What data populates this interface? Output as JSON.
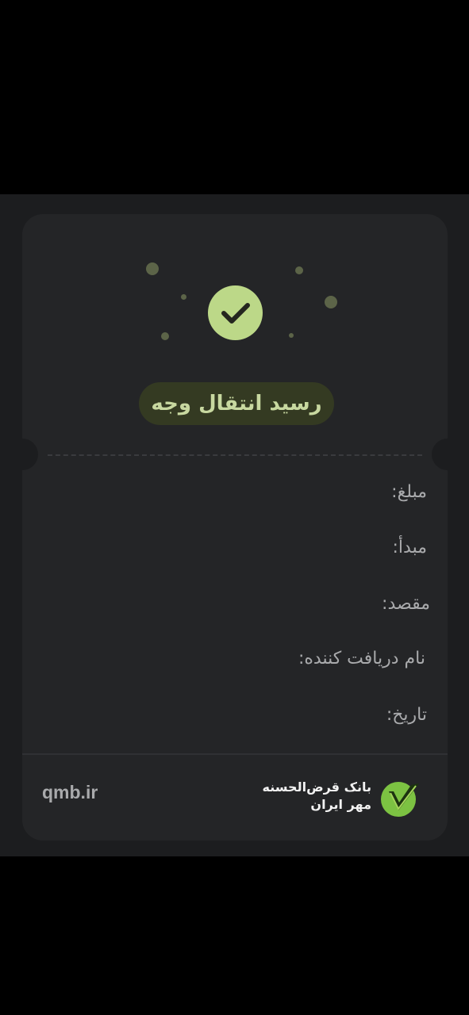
{
  "receipt": {
    "title": "رسید انتقال وجه",
    "fields": {
      "amount_label": "مبلغ:",
      "source_label": "مبدأ:",
      "destination_label": "مقصد:",
      "recipient_label": "نام دریافت کننده:",
      "date_label": "تاریخ:"
    }
  },
  "footer": {
    "website": "qmb.ir",
    "bank_name_line1": "بانک قرض‌الحسنه",
    "bank_name_line2": "مهر ایران"
  },
  "colors": {
    "accent": "#bcd888",
    "pill_bg": "#343a22",
    "card_bg": "#242527",
    "brand_green": "#7cc242"
  },
  "icons": {
    "success": "check-icon",
    "brand": "bank-logo-icon"
  }
}
